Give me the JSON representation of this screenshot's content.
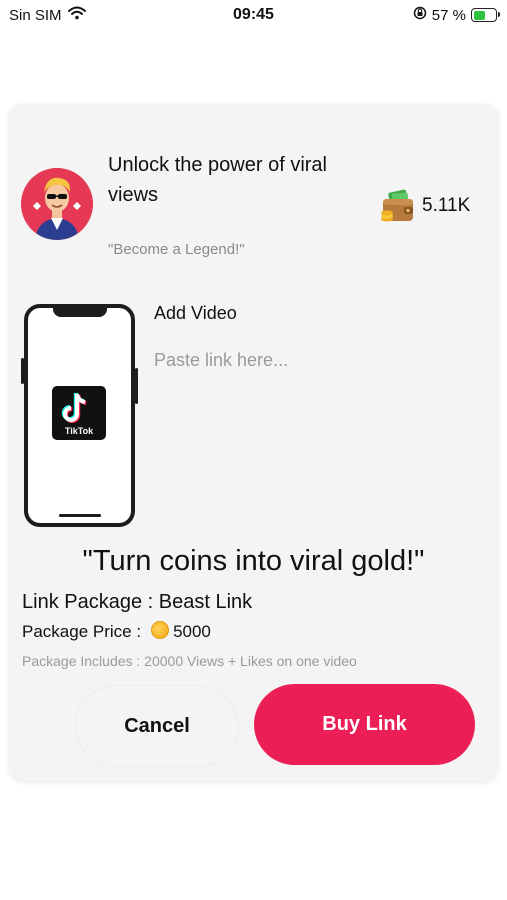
{
  "status_bar": {
    "carrier": "Sin SIM",
    "time": "09:45",
    "battery_percent": "57 %",
    "battery_level": 0.57
  },
  "header": {
    "headline": "Unlock the power of viral views",
    "tagline": "\"Become a Legend!\"",
    "coins_value": "5.11K"
  },
  "video": {
    "label": "Add Video",
    "placeholder": "Paste link here...",
    "value": "",
    "platform_logo_text": "TikTok"
  },
  "package": {
    "slogan": "\"Turn coins into viral gold!\"",
    "package_line": "Link Package : Beast Link",
    "price_label": "Package Price :",
    "price_value": "5000",
    "includes": "Package Includes : 20000 Views + Likes on one video"
  },
  "actions": {
    "cancel_label": "Cancel",
    "buy_label": "Buy Link"
  },
  "colors": {
    "accent": "#eb1f55",
    "avatar_bg": "#e63955",
    "card_bg": "#f4f4f4"
  }
}
